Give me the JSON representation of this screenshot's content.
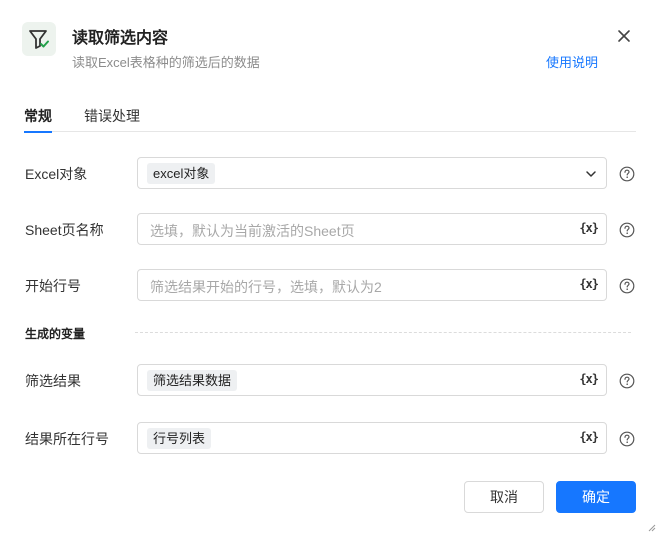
{
  "header": {
    "title": "读取筛选内容",
    "subtitle": "读取Excel表格种的筛选后的数据",
    "help_link": "使用说明"
  },
  "tabs": [
    {
      "label": "常规",
      "active": true
    },
    {
      "label": "错误处理",
      "active": false
    }
  ],
  "fields": {
    "excel_object": {
      "label": "Excel对象",
      "value": "excel对象"
    },
    "sheet_name": {
      "label": "Sheet页名称",
      "placeholder": "选填，默认为当前激活的Sheet页"
    },
    "start_row": {
      "label": "开始行号",
      "placeholder": "筛选结果开始的行号，选填，默认为2"
    }
  },
  "output_section": {
    "title": "生成的变量",
    "filter_result": {
      "label": "筛选结果",
      "value": "筛选结果数据"
    },
    "result_row": {
      "label": "结果所在行号",
      "value": "行号列表"
    }
  },
  "variable_icon": "{x}",
  "footer": {
    "cancel_label": "取消",
    "ok_label": "确定"
  },
  "colors": {
    "accent": "#1677ff",
    "icon_green": "#22a04a"
  }
}
